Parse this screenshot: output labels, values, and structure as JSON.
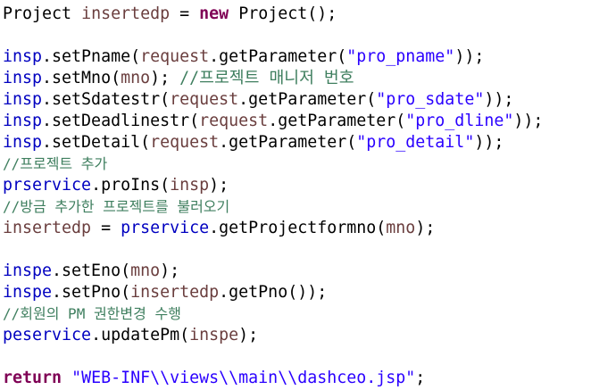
{
  "editor": {
    "colors": {
      "background": "#ffffff",
      "plain": "#000000",
      "variable": "#6a3e3e",
      "object": "#0000c0",
      "keyword": "#7f0055",
      "string": "#2a00ff",
      "comment": "#3f7f5f"
    },
    "lines": [
      {
        "tokens": [
          {
            "t": "plain",
            "v": "Project "
          },
          {
            "t": "var",
            "v": "insertedp"
          },
          {
            "t": "plain",
            "v": " = "
          },
          {
            "t": "kw",
            "v": "new"
          },
          {
            "t": "plain",
            "v": " Project();"
          }
        ]
      },
      {
        "tokens": []
      },
      {
        "tokens": [
          {
            "t": "obj",
            "v": "insp"
          },
          {
            "t": "plain",
            "v": ".setPname("
          },
          {
            "t": "var",
            "v": "request"
          },
          {
            "t": "plain",
            "v": ".getParameter("
          },
          {
            "t": "str",
            "v": "\"pro_pname\""
          },
          {
            "t": "plain",
            "v": "));"
          }
        ]
      },
      {
        "tokens": [
          {
            "t": "obj",
            "v": "insp"
          },
          {
            "t": "plain",
            "v": ".setMno("
          },
          {
            "t": "var",
            "v": "mno"
          },
          {
            "t": "plain",
            "v": "); "
          },
          {
            "t": "comment",
            "v": "//프로젝트 매니저 번호"
          }
        ]
      },
      {
        "tokens": [
          {
            "t": "obj",
            "v": "insp"
          },
          {
            "t": "plain",
            "v": ".setSdatestr("
          },
          {
            "t": "var",
            "v": "request"
          },
          {
            "t": "plain",
            "v": ".getParameter("
          },
          {
            "t": "str",
            "v": "\"pro_sdate\""
          },
          {
            "t": "plain",
            "v": "));"
          }
        ]
      },
      {
        "tokens": [
          {
            "t": "obj",
            "v": "insp"
          },
          {
            "t": "plain",
            "v": ".setDeadlinestr("
          },
          {
            "t": "var",
            "v": "request"
          },
          {
            "t": "plain",
            "v": ".getParameter("
          },
          {
            "t": "str",
            "v": "\"pro_dline\""
          },
          {
            "t": "plain",
            "v": "));"
          }
        ]
      },
      {
        "tokens": [
          {
            "t": "obj",
            "v": "insp"
          },
          {
            "t": "plain",
            "v": ".setDetail("
          },
          {
            "t": "var",
            "v": "request"
          },
          {
            "t": "plain",
            "v": ".getParameter("
          },
          {
            "t": "str",
            "v": "\"pro_detail\""
          },
          {
            "t": "plain",
            "v": "));"
          }
        ]
      },
      {
        "comment": true,
        "tokens": [
          {
            "t": "comment",
            "v": "//프로젝트 추가"
          }
        ]
      },
      {
        "tokens": [
          {
            "t": "obj",
            "v": "prservice"
          },
          {
            "t": "plain",
            "v": ".proIns("
          },
          {
            "t": "var",
            "v": "insp"
          },
          {
            "t": "plain",
            "v": ");"
          }
        ]
      },
      {
        "comment": true,
        "tokens": [
          {
            "t": "comment",
            "v": "//방금 추가한 프로젝트를 불러오기"
          }
        ]
      },
      {
        "tokens": [
          {
            "t": "var",
            "v": "insertedp"
          },
          {
            "t": "plain",
            "v": " = "
          },
          {
            "t": "obj",
            "v": "prservice"
          },
          {
            "t": "plain",
            "v": ".getProjectformno("
          },
          {
            "t": "var",
            "v": "mno"
          },
          {
            "t": "plain",
            "v": ");"
          }
        ]
      },
      {
        "tokens": []
      },
      {
        "tokens": [
          {
            "t": "obj",
            "v": "inspe"
          },
          {
            "t": "plain",
            "v": ".setEno("
          },
          {
            "t": "var",
            "v": "mno"
          },
          {
            "t": "plain",
            "v": ");"
          }
        ]
      },
      {
        "tokens": [
          {
            "t": "obj",
            "v": "inspe"
          },
          {
            "t": "plain",
            "v": ".setPno("
          },
          {
            "t": "var",
            "v": "insertedp"
          },
          {
            "t": "plain",
            "v": ".getPno());"
          }
        ]
      },
      {
        "comment": true,
        "tokens": [
          {
            "t": "comment",
            "v": "//회원의 PM 권한변경 수행"
          }
        ]
      },
      {
        "tokens": [
          {
            "t": "obj",
            "v": "peservice"
          },
          {
            "t": "plain",
            "v": ".updatePm("
          },
          {
            "t": "var",
            "v": "inspe"
          },
          {
            "t": "plain",
            "v": ");"
          }
        ]
      },
      {
        "tokens": []
      },
      {
        "tokens": [
          {
            "t": "kw",
            "v": "return"
          },
          {
            "t": "plain",
            "v": " "
          },
          {
            "t": "str",
            "v": "\"WEB-INF\\\\views\\\\main\\\\dashceo.jsp\""
          },
          {
            "t": "plain",
            "v": ";"
          }
        ]
      }
    ]
  }
}
